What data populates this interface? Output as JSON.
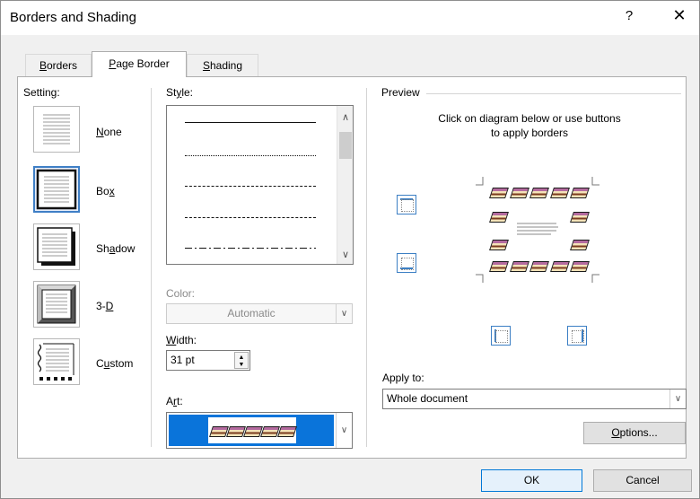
{
  "window": {
    "title": "Borders and Shading",
    "help_glyph": "?",
    "close_glyph": "✕"
  },
  "tabs": [
    {
      "label": "Borders",
      "mnemonic_first": "B",
      "rest": "orders",
      "active": false
    },
    {
      "label": "Page Border",
      "mnemonic_first": "P",
      "rest": "age Border",
      "active": true
    },
    {
      "label": "Shading",
      "mnemonic_first": "S",
      "rest": "hading",
      "active": false
    }
  ],
  "setting": {
    "label": "Setting:",
    "options": [
      {
        "name": "None",
        "pre": "",
        "mn": "N",
        "post": "one",
        "selected": false
      },
      {
        "name": "Box",
        "pre": "Bo",
        "mn": "x",
        "post": "",
        "selected": true
      },
      {
        "name": "Shadow",
        "pre": "Sh",
        "mn": "a",
        "post": "dow",
        "selected": false
      },
      {
        "name": "3-D",
        "pre": "3-",
        "mn": "D",
        "post": "",
        "selected": false
      },
      {
        "name": "Custom",
        "pre": "C",
        "mn": "u",
        "post": "stom",
        "selected": false
      }
    ]
  },
  "style": {
    "label_pre": "St",
    "label_mn": "y",
    "label_post": "le:"
  },
  "color": {
    "label": "Color:",
    "value": "Automatic",
    "disabled": true
  },
  "width": {
    "label_mn": "W",
    "label_post": "idth:",
    "value": "31 pt"
  },
  "art": {
    "label_pre": "A",
    "label_mn": "r",
    "label_post": "t:",
    "selection_color": "#0a74da"
  },
  "preview": {
    "label": "Preview",
    "instruction_line1": "Click on diagram below or use buttons",
    "instruction_line2": "to apply borders"
  },
  "apply_to": {
    "label": "Apply to:",
    "value": "Whole document"
  },
  "buttons": {
    "options_mn": "O",
    "options_post": "ptions...",
    "ok": "OK",
    "cancel": "Cancel"
  },
  "icons": {
    "combo_arrow": "∨",
    "scroll_up": "∧",
    "scroll_down": "∨",
    "spin_up": "▲",
    "spin_down": "▼"
  }
}
